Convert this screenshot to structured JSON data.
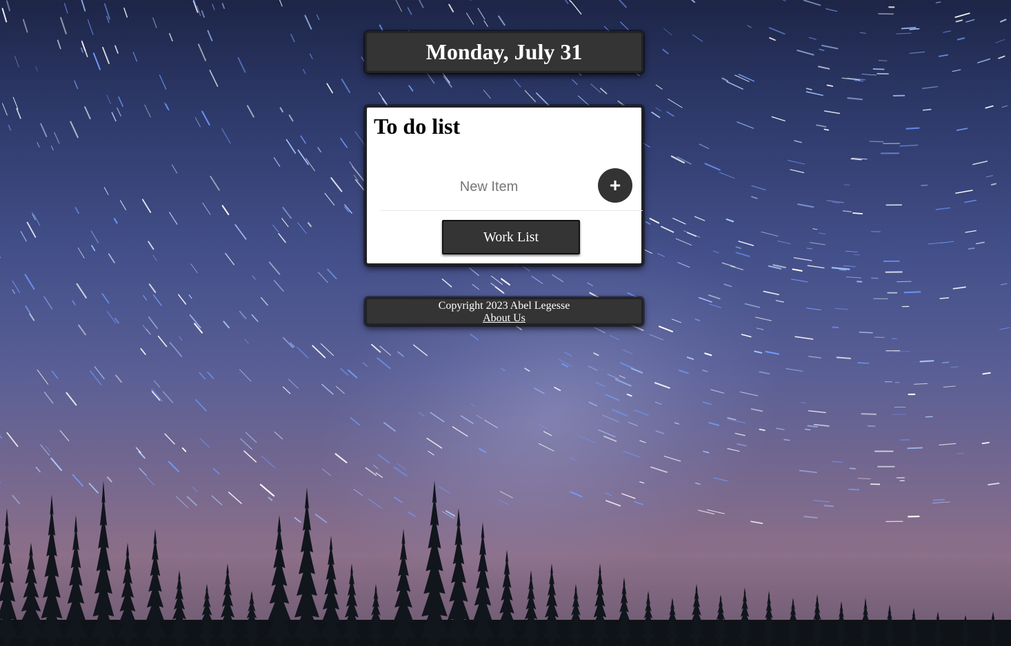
{
  "header": {
    "date_title": "Monday, July 31"
  },
  "todo": {
    "title": "To do list",
    "new_item_placeholder": "New Item",
    "add_button_label": "+",
    "work_list_button_label": "Work List"
  },
  "footer": {
    "copyright": "Copyright 2023 Abel Legesse",
    "about_link": "About Us"
  },
  "colors": {
    "panel_dark": "#343434",
    "panel_light": "#ffffff",
    "text_light": "#ffffff"
  },
  "icons": {
    "add": "plus-icon"
  }
}
